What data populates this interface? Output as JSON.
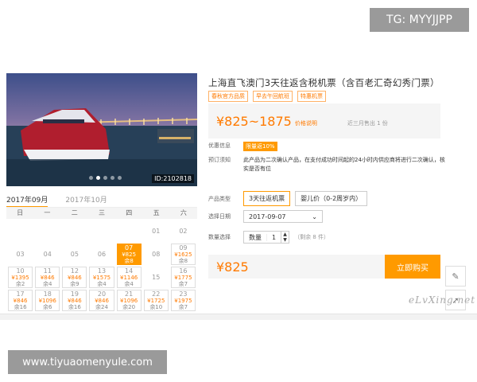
{
  "overlay": {
    "tg_badge": "TG: MYYJJPP",
    "url_badge": "www.tiyuaomenyule.com",
    "watermark": "eLvXing.net"
  },
  "product": {
    "title": "上海直飞澳门3天往返含税机票（含百老汇奇幻秀门票）",
    "tags": [
      "春秋官方品质",
      "早去午回航班",
      "特惠机票"
    ],
    "price_range": "¥825~1875",
    "price_note": "价格说明",
    "sold": "近三月售出 1 份",
    "photo_id": "ID:2102818",
    "photo_page": 2,
    "photo_pages": 5
  },
  "promo": {
    "label": "优惠信息",
    "badge": "限量返10%"
  },
  "rules": {
    "label": "预订须知",
    "text": "此产品为二次确认产品，在支付成功时间起的24小时内供应商将进行二次确认，核实是否有位"
  },
  "product_type": {
    "label": "产品类型",
    "options": [
      "3天往返机票",
      "婴儿价（0-2周岁内）"
    ],
    "selected": 0
  },
  "date": {
    "label": "选择日期",
    "value": "2017-09-07"
  },
  "quantity": {
    "label": "数量选择",
    "name": "数量",
    "value": "1",
    "remain": "（剩余 8 件）"
  },
  "buy": {
    "price": "¥825",
    "button": "立即购买"
  },
  "calendar": {
    "tabs": [
      "2017年09月",
      "2017年10月"
    ],
    "weekdays": [
      "日",
      "一",
      "二",
      "三",
      "四",
      "五",
      "六"
    ],
    "cells": [
      {
        "d": "",
        "p": "",
        "s": "",
        "state": "empty"
      },
      {
        "d": "",
        "p": "",
        "s": "",
        "state": "empty"
      },
      {
        "d": "",
        "p": "",
        "s": "",
        "state": "empty"
      },
      {
        "d": "",
        "p": "",
        "s": "",
        "state": "empty"
      },
      {
        "d": "",
        "p": "",
        "s": "",
        "state": "empty"
      },
      {
        "d": "01",
        "p": "",
        "s": "",
        "state": "plain"
      },
      {
        "d": "02",
        "p": "",
        "s": "",
        "state": "plain"
      },
      {
        "d": "03",
        "p": "",
        "s": "",
        "state": "plain"
      },
      {
        "d": "04",
        "p": "",
        "s": "",
        "state": "plain"
      },
      {
        "d": "05",
        "p": "",
        "s": "",
        "state": "plain"
      },
      {
        "d": "06",
        "p": "",
        "s": "",
        "state": "plain"
      },
      {
        "d": "07",
        "p": "¥825",
        "s": "余8",
        "state": "sel"
      },
      {
        "d": "08",
        "p": "",
        "s": "",
        "state": "plain"
      },
      {
        "d": "09",
        "p": "¥1625",
        "s": "余8",
        "state": "avail"
      },
      {
        "d": "10",
        "p": "¥1395",
        "s": "余2",
        "state": "avail"
      },
      {
        "d": "11",
        "p": "¥846",
        "s": "余4",
        "state": "avail"
      },
      {
        "d": "12",
        "p": "¥846",
        "s": "余9",
        "state": "avail"
      },
      {
        "d": "13",
        "p": "¥1575",
        "s": "余4",
        "state": "avail"
      },
      {
        "d": "14",
        "p": "¥1146",
        "s": "余4",
        "state": "avail"
      },
      {
        "d": "15",
        "p": "",
        "s": "",
        "state": "plain"
      },
      {
        "d": "16",
        "p": "¥1775",
        "s": "余7",
        "state": "avail"
      },
      {
        "d": "17",
        "p": "¥846",
        "s": "余16",
        "state": "avail"
      },
      {
        "d": "18",
        "p": "¥1096",
        "s": "余6",
        "state": "avail"
      },
      {
        "d": "19",
        "p": "¥846",
        "s": "余16",
        "state": "avail"
      },
      {
        "d": "20",
        "p": "¥846",
        "s": "余24",
        "state": "avail"
      },
      {
        "d": "21",
        "p": "¥1096",
        "s": "余20",
        "state": "avail"
      },
      {
        "d": "22",
        "p": "¥1725",
        "s": "余10",
        "state": "avail"
      },
      {
        "d": "23",
        "p": "¥1975",
        "s": "余7",
        "state": "avail"
      }
    ]
  }
}
